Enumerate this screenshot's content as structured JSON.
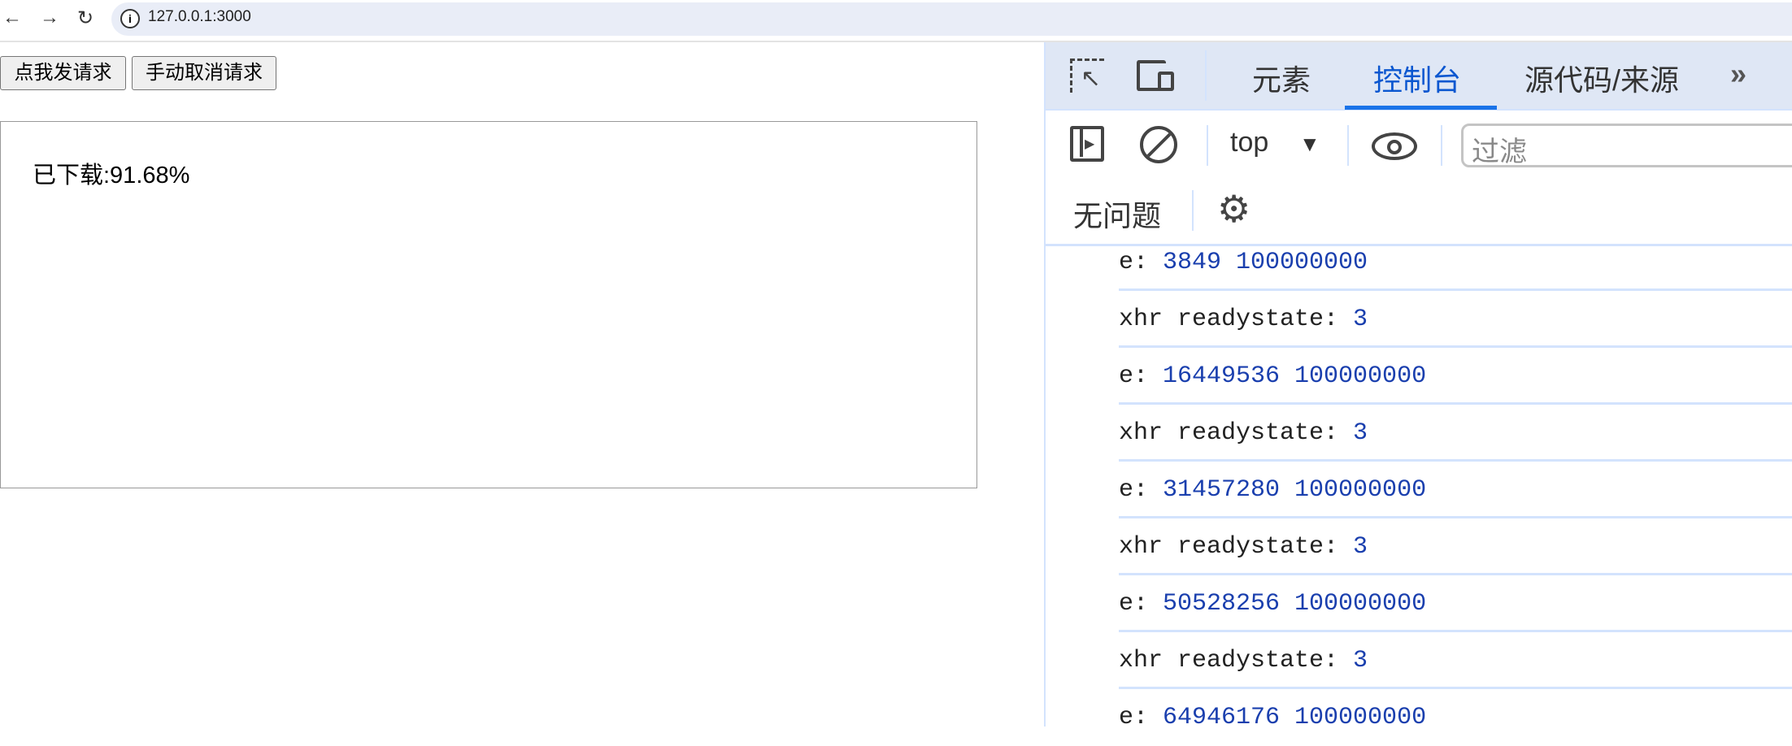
{
  "browser": {
    "url": "127.0.0.1:3000"
  },
  "page": {
    "buttons": {
      "send": "点我发请求",
      "cancel": "手动取消请求"
    },
    "progress_text": "已下载:91.68%"
  },
  "devtools": {
    "tabs": [
      {
        "label": "元素"
      },
      {
        "label": "控制台",
        "active": true
      },
      {
        "label": "源代码/来源"
      }
    ],
    "context": "top",
    "filter_placeholder": "过滤",
    "issues": "无问题",
    "accent": "#0b57d0",
    "console": [
      {
        "label": "e: ",
        "value": "3849 100000000"
      },
      {
        "label": "xhr readystate: ",
        "value": "3"
      },
      {
        "label": "e: ",
        "value": "16449536 100000000"
      },
      {
        "label": "xhr readystate: ",
        "value": "3"
      },
      {
        "label": "e: ",
        "value": "31457280 100000000"
      },
      {
        "label": "xhr readystate: ",
        "value": "3"
      },
      {
        "label": "e: ",
        "value": "50528256 100000000"
      },
      {
        "label": "xhr readystate: ",
        "value": "3"
      },
      {
        "label": "e: ",
        "value": "64946176 100000000"
      }
    ]
  }
}
